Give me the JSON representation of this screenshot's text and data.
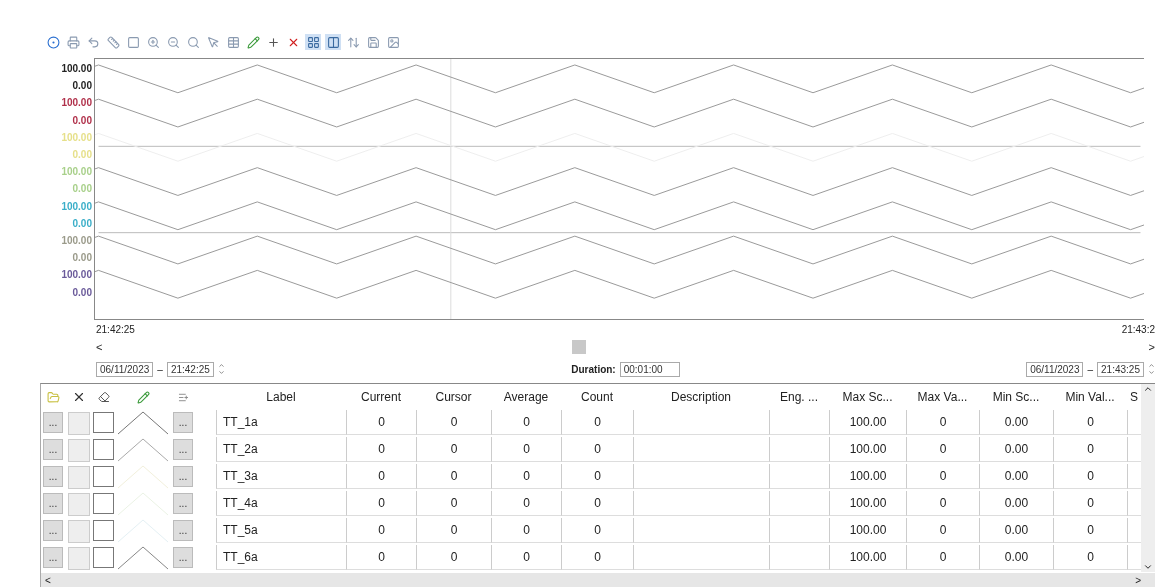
{
  "pens": [
    {
      "max": "100.00",
      "min": "0.00",
      "color": "#222222"
    },
    {
      "max": "100.00",
      "min": "0.00",
      "color": "#b0304a"
    },
    {
      "max": "100.00",
      "min": "0.00",
      "color": "#e6e08a"
    },
    {
      "max": "100.00",
      "min": "0.00",
      "color": "#a8d08a"
    },
    {
      "max": "100.00",
      "min": "0.00",
      "color": "#3aaec8"
    },
    {
      "max": "100.00",
      "min": "0.00",
      "color": "#9a9a8a"
    },
    {
      "max": "100.00",
      "min": "0.00",
      "color": "#6a5a9a"
    }
  ],
  "time_axis": {
    "start": "21:42:25",
    "end": "21:43:2"
  },
  "scrollbar": {
    "left": "<",
    "right": ">"
  },
  "range": {
    "start_date": "06/11/2023",
    "start_time": "21:42:25",
    "duration_label": "Duration:",
    "duration": "00:01:00",
    "end_date": "06/11/2023",
    "end_time": "21:43:25",
    "separator": "–"
  },
  "table": {
    "columns": [
      "Label",
      "Current",
      "Cursor",
      "Average",
      "Count",
      "Description",
      "Eng. ...",
      "Max Sc...",
      "Max Va...",
      "Min Sc...",
      "Min Val...",
      "S"
    ],
    "rows": [
      {
        "label": "TT_1a",
        "stats": [
          "0",
          "0",
          "0",
          "0"
        ],
        "scales": [
          "100.00",
          "0",
          "0.00",
          "0"
        ],
        "checked": false,
        "color": "#777777",
        "buttons": [
          "...",
          "..."
        ]
      },
      {
        "label": "TT_2a",
        "stats": [
          "0",
          "0",
          "0",
          "0"
        ],
        "scales": [
          "100.00",
          "0",
          "0.00",
          "0"
        ],
        "checked": false,
        "color": "#aaaaaa",
        "buttons": [
          "...",
          "..."
        ]
      },
      {
        "label": "TT_3a",
        "stats": [
          "0",
          "0",
          "0",
          "0"
        ],
        "scales": [
          "100.00",
          "0",
          "0.00",
          "0"
        ],
        "checked": false,
        "color": "#f2f0dc",
        "buttons": [
          "...",
          "..."
        ]
      },
      {
        "label": "TT_4a",
        "stats": [
          "0",
          "0",
          "0",
          "0"
        ],
        "scales": [
          "100.00",
          "0",
          "0.00",
          "0"
        ],
        "checked": false,
        "color": "#eaf2e4",
        "buttons": [
          "...",
          "..."
        ]
      },
      {
        "label": "TT_5a",
        "stats": [
          "0",
          "0",
          "0",
          "0"
        ],
        "scales": [
          "100.00",
          "0",
          "0.00",
          "0"
        ],
        "checked": false,
        "color": "#e4f0f4",
        "buttons": [
          "...",
          "..."
        ]
      },
      {
        "label": "TT_6a",
        "stats": [
          "0",
          "0",
          "0",
          "0"
        ],
        "scales": [
          "100.00",
          "0",
          "0.00",
          "0"
        ],
        "checked": false,
        "color": "#888888",
        "buttons": [
          "...",
          "..."
        ]
      }
    ]
  },
  "hscroll": {
    "left": "<",
    "right": ">"
  }
}
